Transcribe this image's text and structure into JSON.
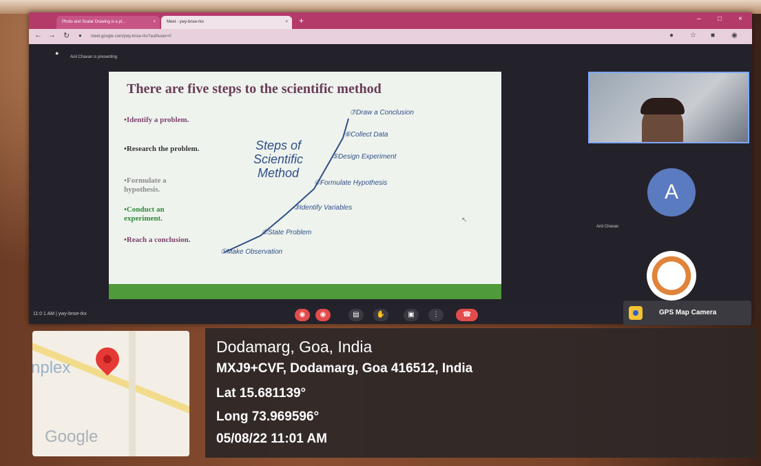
{
  "browser": {
    "tabs": [
      {
        "label": "Photo and Scalar Drawing is a pl..."
      },
      {
        "label": "Meet - ywy-bnse-rkx"
      }
    ],
    "url": "meet.google.com/ywy-bnse-rkx?authuser=0"
  },
  "meet": {
    "presenting_note": "Anil Chavan is presenting",
    "meeting_code": "11:0 1 AM | ywy-bnse-rkx",
    "participant_name": "Anil Chavan",
    "avatar_letter": "A"
  },
  "slide": {
    "title": "There are five steps to the scientific method",
    "bullets": [
      {
        "text": "•Identify a problem.",
        "color": "#7b3f6a"
      },
      {
        "text": "•Research the problem.",
        "color": "#333333"
      },
      {
        "text": "•Formulate a hypothesis.",
        "color": "#8a8a8a"
      },
      {
        "text": "•Conduct an experiment.",
        "color": "#2f8a3a"
      },
      {
        "text": "•Reach a conclusion.",
        "color": "#7b3f6a"
      }
    ],
    "steps_heading": "Steps of Scientific Method",
    "steps": [
      "①Make Observation",
      "②State Problem",
      "③Identify Variables",
      "④Formulate Hypothesis",
      "⑤Design Experiment",
      "⑥Collect Data",
      "⑦Draw a Conclusion"
    ]
  },
  "gps": {
    "app_name": "GPS Map Camera",
    "map_place_fragment": "nplex",
    "map_logo": "Google",
    "location_title": "Dodamarg, Goa, India",
    "address": "MXJ9+CVF, Dodamarg, Goa 416512, India",
    "lat": "Lat 15.681139°",
    "long": "Long 73.969596°",
    "datetime": "05/08/22 11:01 AM"
  }
}
